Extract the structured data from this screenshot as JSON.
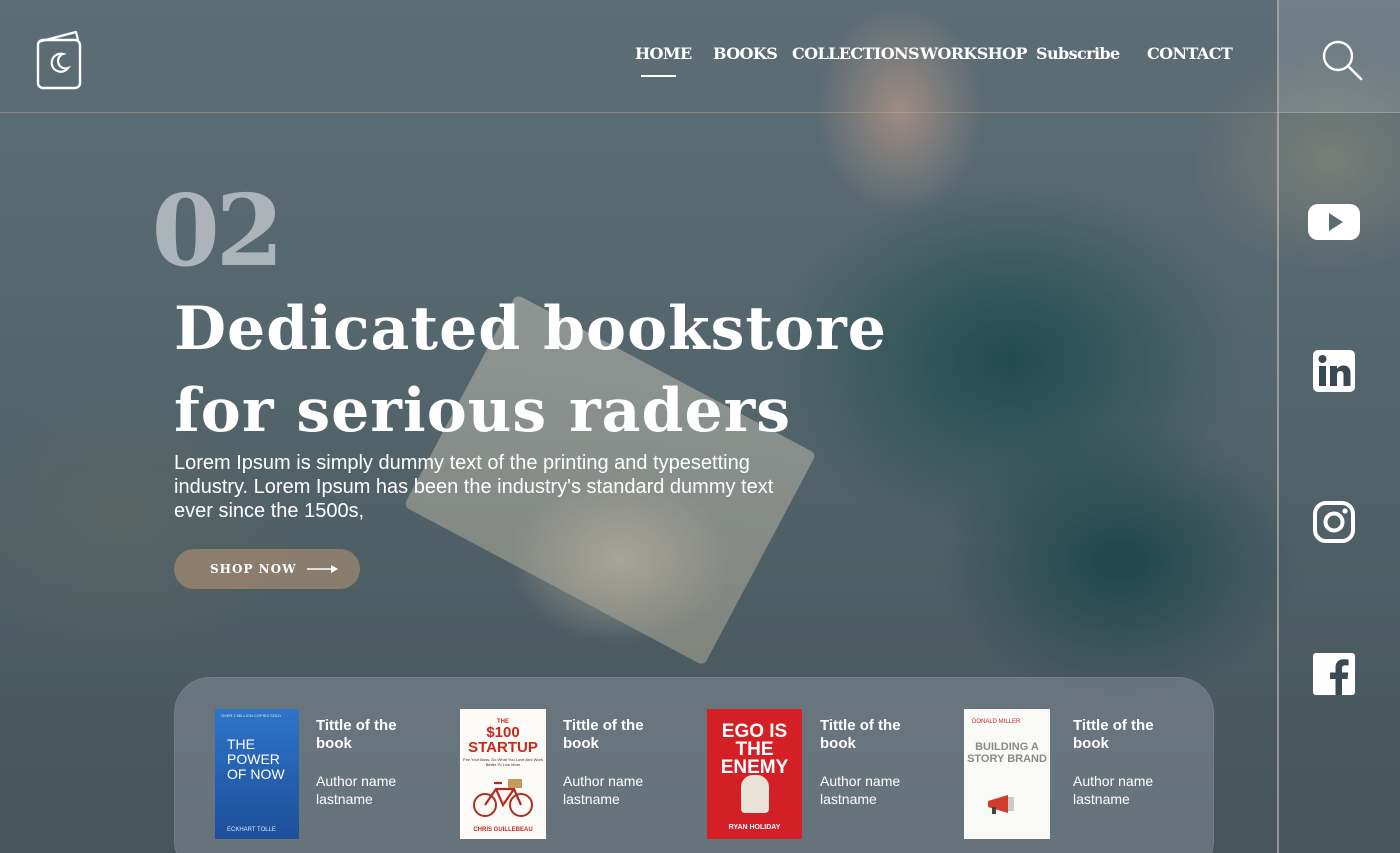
{
  "nav": {
    "items": [
      {
        "label": "HOME",
        "active": true
      },
      {
        "label": "BOOKS"
      },
      {
        "label": "COLLECTIONS"
      },
      {
        "label": "WORKSHOP"
      },
      {
        "label": "Subscribe"
      },
      {
        "label": "CONTACT"
      }
    ]
  },
  "hero": {
    "index": "02",
    "title_line1": "Dedicated bookstore",
    "title_line2": "for serious raders",
    "description": "Lorem Ipsum is simply dummy text of the printing and typesetting industry. Lorem Ipsum has been the industry's standard dummy text ever since the 1500s,",
    "cta_label": "SHOP NOW"
  },
  "social": [
    "youtube-icon",
    "linkedin-icon",
    "instagram-icon",
    "facebook-icon"
  ],
  "books": [
    {
      "title": "Tittle of the book",
      "author": "Author name lastname",
      "cover": {
        "kicker": "OVER 2 MILLION COPIES SOLD",
        "title": "THE POWER OF NOW",
        "author": "ECKHART TOLLE",
        "color": "#2f74c8"
      }
    },
    {
      "title": "Tittle of the book",
      "author": "Author name lastname",
      "cover": {
        "kicker": "THE",
        "title": "$100 STARTUP",
        "subtitle": "Fire Your Boss, Do What You Love And Work Better To Live More",
        "author": "CHRIS GUILLEBEAU",
        "color": "#fdfbf7"
      }
    },
    {
      "title": "Tittle of the book",
      "author": "Author name lastname",
      "cover": {
        "title": "EGO IS THE ENEMY",
        "author": "RYAN HOLIDAY",
        "color": "#d41f26"
      }
    },
    {
      "title": "Tittle of the book",
      "author": "Author name lastname",
      "cover": {
        "author": "DONALD MILLER",
        "title": "BUILDING A STORY BRAND",
        "color": "#f9f9f6"
      }
    }
  ],
  "colors": {
    "accent_button": "#96826e",
    "text": "#ffffff",
    "cover_red": "#d41f26"
  }
}
